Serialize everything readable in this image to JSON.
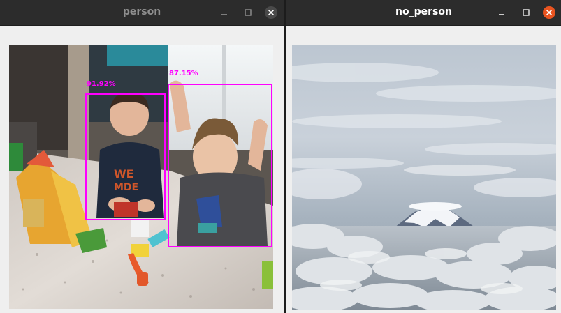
{
  "windows": [
    {
      "title": "person",
      "detections": [
        {
          "label": "91.92%"
        },
        {
          "label": "87.15%"
        }
      ]
    },
    {
      "title": "no_person"
    }
  ],
  "colors": {
    "titlebar_bg": "#2c2c2c",
    "window_bg": "#efefef",
    "detection_box": "#ff00ff",
    "close_button_active": "#e95420"
  },
  "icons": [
    "minimize-icon",
    "maximize-icon",
    "close-icon"
  ]
}
